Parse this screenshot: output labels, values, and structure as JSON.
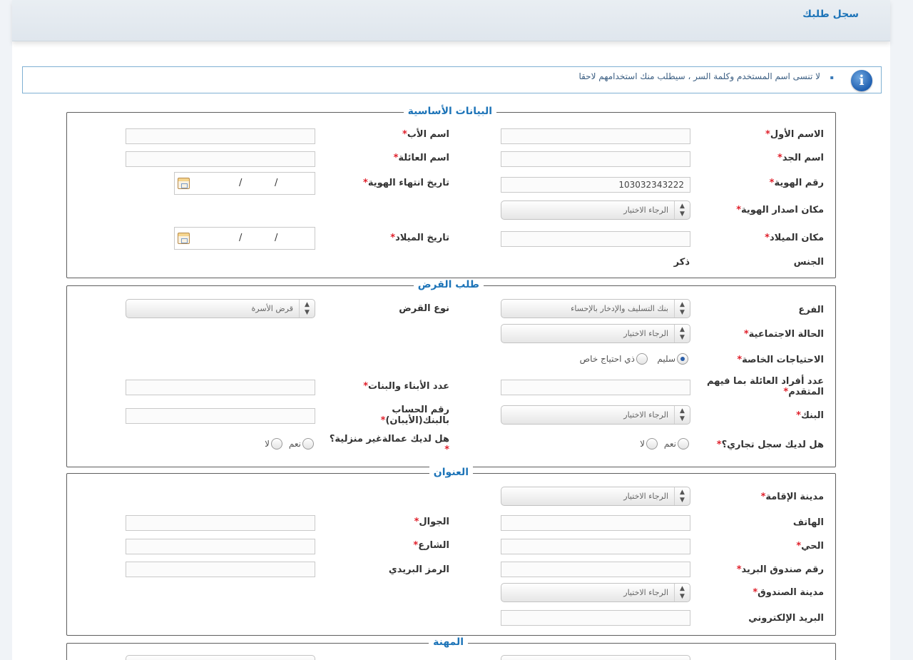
{
  "header": {
    "title": "سجل طلبك"
  },
  "notice": {
    "icon": "info-icon",
    "text": "لا تنسى اسم المستخدم وكلمة السر ، سيطلب منك استخدامهم لاحقا"
  },
  "basic": {
    "legend": "البيانات الأساسية",
    "first_name": "الاسم الأول",
    "father_name": "اسم الأب",
    "grandfather_name": "اسم الجد",
    "family_name": "اسم العائلة",
    "id_number": "رقم الهوية",
    "id_number_value": "103032343222",
    "id_expiry": "تاريخ انتهاء الهوية",
    "id_issue_place": "مكان اصدار الهوية",
    "birth_place": "مكان الميلاد",
    "birth_date": "تاريخ الميلاد",
    "gender": "الجنس",
    "gender_value": "ذكر"
  },
  "loan": {
    "legend": "طلب القرض",
    "branch": "الفرع",
    "branch_value": "بنك التسليف والإدخار بالإحساء",
    "loan_type": "نوع القرض",
    "loan_type_value": "قرض الأسرة",
    "marital_status": "الحالة الاجتماعية",
    "special_needs": "الاحتياجات الخاصة",
    "healthy": "سليم",
    "special_need_option": "ذي احتياج خاص",
    "family_members": "عدد أفراد العائلة بما فيهم المتقدم",
    "children_count": "عدد الأبناء والبنات",
    "bank": "البنك",
    "iban": "رقم الحساب بالبنك(الأيبان)",
    "commercial_record": "هل لديك سجل تجاري؟",
    "domestic_labor": "هل لديك عمالةغير منزلية؟",
    "yes": "نعم",
    "no": "لا"
  },
  "address": {
    "legend": "العنوان",
    "residence_city": "مدينة الإقامة",
    "phone": "الهاتف",
    "mobile": "الجوال",
    "district": "الحي",
    "street": "الشارع",
    "po_box": "رقم صندوق البريد",
    "postal_code": "الرمز البريدي",
    "box_city": "مدينة الصندوق",
    "email": "البريد الإلكتروني"
  },
  "job": {
    "legend": "المهنة"
  },
  "common": {
    "select_placeholder": "الرجاء الاختيار",
    "required_mark": "*",
    "date_sep": "/"
  }
}
